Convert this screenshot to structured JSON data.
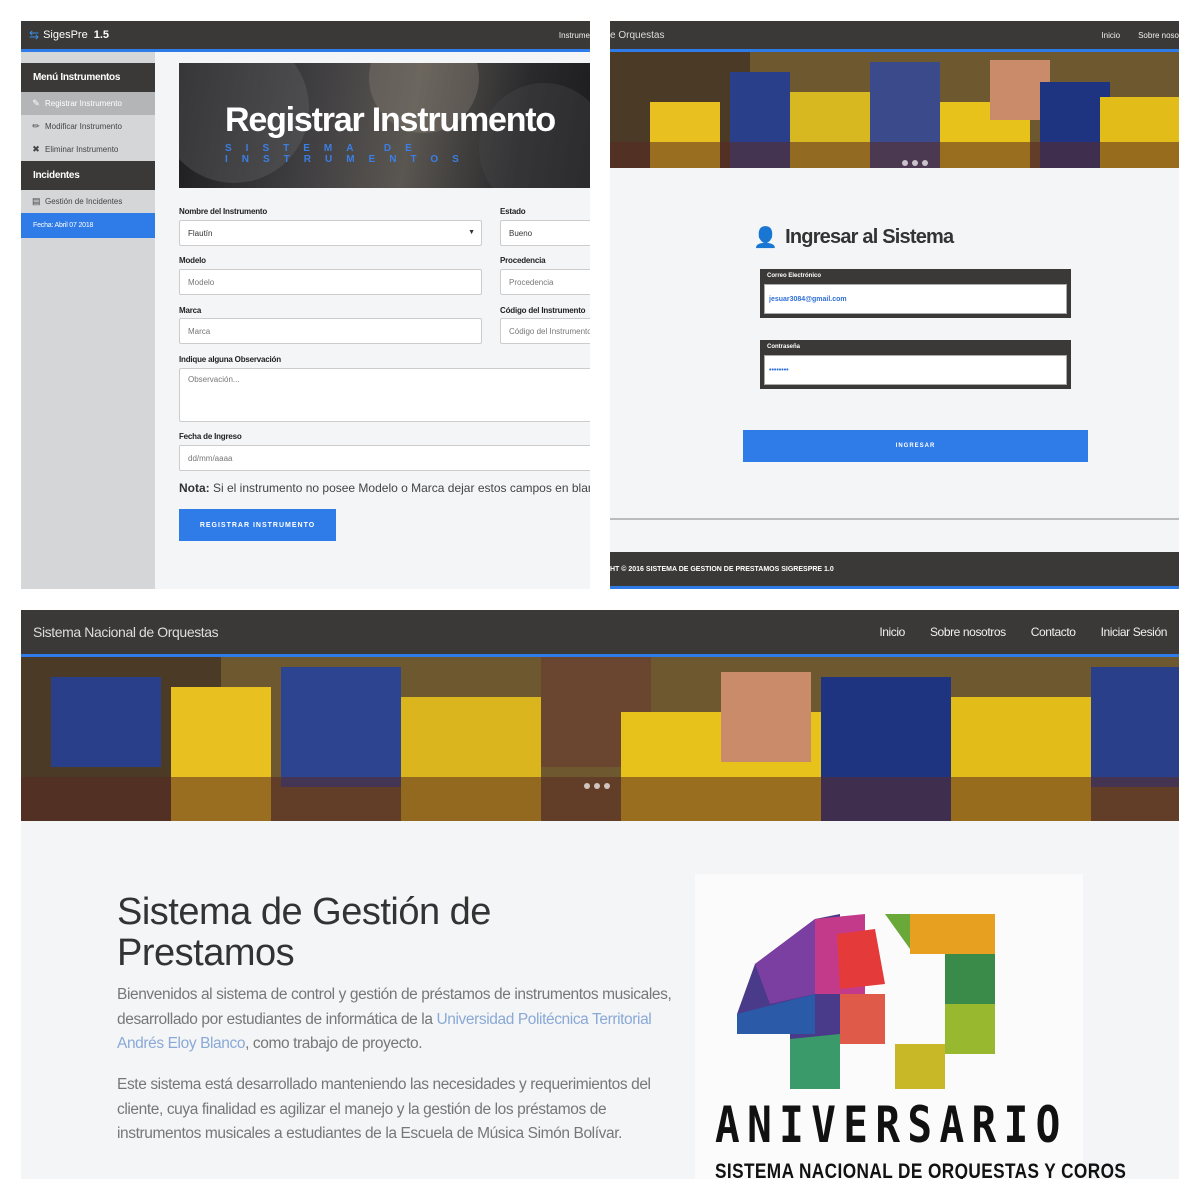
{
  "register": {
    "brand_name": "SigesPre",
    "brand_version": "1.5",
    "nav_link": "Instrume",
    "sidebar": {
      "menu_header": "Menú Instrumentos",
      "items": [
        {
          "icon": "edit-icon",
          "label": "Registrar Instrumento"
        },
        {
          "icon": "pencil-icon",
          "label": "Modificar Instrumento"
        },
        {
          "icon": "x-icon",
          "label": "Eliminar Instrumento"
        }
      ],
      "incidents_header": "Incidentes",
      "incidents_items": [
        {
          "icon": "list-icon",
          "label": "Gestión de Incidentes"
        }
      ],
      "date": "Fecha: Abril 07 2018"
    },
    "hero_title": "Registrar Instrumento",
    "hero_subtitle": "SISTEMA DE INSTRUMENTOS",
    "fields": {
      "name_label": "Nombre del Instrumento",
      "name_value": "Flautín",
      "state_label": "Estado",
      "state_value": "Bueno",
      "model_label": "Modelo",
      "model_placeholder": "Modelo",
      "origin_label": "Procedencia",
      "origin_placeholder": "Procedencia",
      "brand_label": "Marca",
      "brand_placeholder": "Marca",
      "code_label": "Código del Instrumento",
      "code_placeholder": "Código del Instrumento",
      "obs_label": "Indique alguna Observación",
      "obs_placeholder": "Observación...",
      "date_label": "Fecha de Ingreso",
      "date_placeholder": "dd/mm/aaaa"
    },
    "note_prefix": "Nota:",
    "note_text": " Si el instrumento no posee Modelo o Marca dejar estos campos en blanco",
    "submit": "REGISTRAR INSTRUMENTO"
  },
  "login": {
    "brand_partial": "e Orquestas",
    "nav_links": [
      "Inicio",
      "Sobre noso"
    ],
    "title": "Ingresar al Sistema",
    "email_label": "Correo Electrónico",
    "email_value": "jesuar3084@gmail.com",
    "password_label": "Contraseña",
    "password_value": "••••••••",
    "submit": "INGRESAR",
    "footer": "HT © 2016 SISTEMA DE GESTION DE PRESTAMOS SIGRESPRE 1.0"
  },
  "home": {
    "brand": "Sistema Nacional de Orquestas",
    "nav_links": [
      "Inicio",
      "Sobre nosotros",
      "Contacto",
      "Iniciar Sesión"
    ],
    "title": "Sistema de Gestión de Prestamos",
    "para1_a": "Bienvenidos al sistema de control y gestión de préstamos de instrumentos musicales, desarrollado por estudiantes de informática de la ",
    "para1_link": "Universidad Politécnica Territorial Andrés Eloy Blanco",
    "para1_b": ", como trabajo de proyecto.",
    "para2": "Este sistema está desarrollado manteniendo las necesidades y requerimientos del cliente, cuya finalidad es agilizar el manejo y la gestión de los préstamos de instrumentos musicales a estudiantes de la Escuela de Música Simón Bolívar.",
    "logo_number": "41",
    "logo_word": "ANIVERSARIO",
    "logo_sub": "SISTEMA NACIONAL DE ORQUESTAS Y COROS"
  },
  "colors": {
    "accent": "#2f7be8",
    "navbar": "#3a3938",
    "sidebar": "#d5d6d7"
  }
}
